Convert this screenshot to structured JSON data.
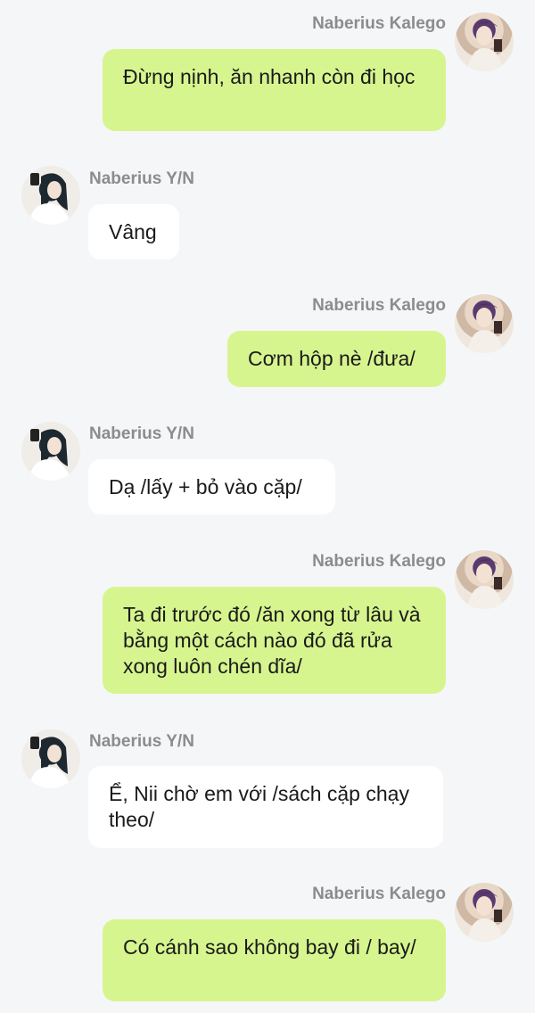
{
  "messages": [
    {
      "side": "right",
      "sender": "Naberius Kalego",
      "text": "Đừng nịnh, ăn nhanh còn đi học",
      "avatar": "kalego-avatar"
    },
    {
      "side": "left",
      "sender": "Naberius Y/N",
      "text": "Vâng",
      "avatar": "yn-avatar"
    },
    {
      "side": "right",
      "sender": "Naberius Kalego",
      "text": "Cơm hộp nè /đưa/",
      "avatar": "kalego-avatar"
    },
    {
      "side": "left",
      "sender": "Naberius Y/N",
      "text": "Dạ /lấy + bỏ vào cặp/",
      "avatar": "yn-avatar"
    },
    {
      "side": "right",
      "sender": "Naberius Kalego",
      "text": "Ta đi trước đó /ăn xong từ lâu và bằng một cách nào đó đã rửa xong luôn chén dĩa/",
      "avatar": "kalego-avatar"
    },
    {
      "side": "left",
      "sender": "Naberius Y/N",
      "text": "Ể, Nii chờ em với /sách cặp chạy theo/",
      "avatar": "yn-avatar"
    },
    {
      "side": "right",
      "sender": "Naberius Kalego",
      "text": "Có cánh sao không bay đi / bay/",
      "avatar": "kalego-avatar"
    }
  ],
  "colors": {
    "background": "#f5f6f8",
    "right_bubble": "#d7f58f",
    "left_bubble": "#ffffff",
    "sender_name": "#8c8c8c"
  }
}
